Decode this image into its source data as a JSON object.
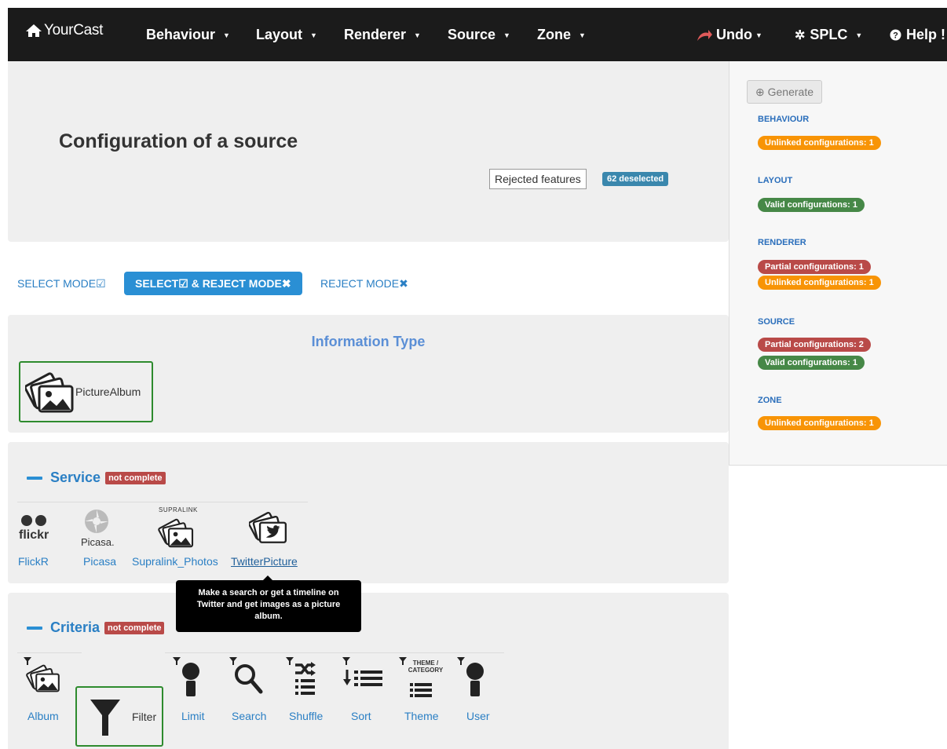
{
  "navbar": {
    "brand": "YourCast",
    "menus": [
      "Behaviour",
      "Layout",
      "Renderer",
      "Source",
      "Zone"
    ],
    "undo": "Undo",
    "splc": "SPLC",
    "help": "Help !"
  },
  "header": {
    "title": "Configuration of a source",
    "rejected_button": "Rejected features",
    "deselected_badge": "62 deselected"
  },
  "sidebar": {
    "generate": "Generate",
    "sections": [
      {
        "heading": "BEHAVIOUR",
        "badges": [
          {
            "text": "Unlinked configurations: 1",
            "status": "orange"
          }
        ]
      },
      {
        "heading": "LAYOUT",
        "badges": [
          {
            "text": "Valid configurations: 1",
            "status": "green"
          }
        ]
      },
      {
        "heading": "RENDERER",
        "badges": [
          {
            "text": "Partial configurations: 1",
            "status": "red"
          },
          {
            "text": "Unlinked configurations: 1",
            "status": "orange"
          }
        ]
      },
      {
        "heading": "SOURCE",
        "badges": [
          {
            "text": "Partial configurations: 2",
            "status": "red"
          },
          {
            "text": "Valid configurations: 1",
            "status": "green"
          }
        ]
      },
      {
        "heading": "ZONE",
        "badges": [
          {
            "text": "Unlinked configurations: 1",
            "status": "orange"
          }
        ]
      }
    ]
  },
  "modes": {
    "select": "SELECT MODE",
    "select_reject": "SELECT",
    "select_reject_suffix": "& REJECT MODE",
    "reject": "REJECT MODE"
  },
  "information_type": {
    "title": "Information Type",
    "feature": "PictureAlbum"
  },
  "service": {
    "title": "Service",
    "badge": "not complete",
    "items": [
      "FlickR",
      "Picasa",
      "Supralink_Photos",
      "TwitterPicture"
    ],
    "logo_text": {
      "flickr": "flickr",
      "picasa": "Picasa.",
      "supralink": "SUPRALINK"
    }
  },
  "tooltip": {
    "text": "Make a search or get a timeline on Twitter and get images as a picture album."
  },
  "criteria": {
    "title": "Criteria",
    "badge": "not complete",
    "items": [
      "Album",
      "Filter",
      "Limit",
      "Search",
      "Shuffle",
      "Sort",
      "Theme",
      "User"
    ],
    "theme_icon_text": "THEME / CATEGORY"
  },
  "colors": {
    "navbar": "#1b1b1b",
    "accent": "#2a7fc4",
    "selected_border": "#2e8b2e",
    "badge_orange": "#f89406",
    "badge_green": "#468847",
    "badge_red": "#b94a48"
  }
}
